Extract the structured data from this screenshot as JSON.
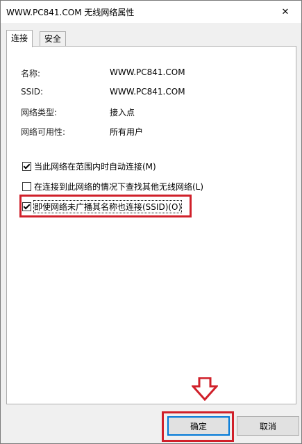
{
  "window": {
    "title": "WWW.PC841.COM 无线网络属性",
    "close_glyph": "✕"
  },
  "tabs": [
    {
      "label": "连接",
      "active": true
    },
    {
      "label": "安全",
      "active": false
    }
  ],
  "properties": [
    {
      "label": "名称:",
      "value": "WWW.PC841.COM"
    },
    {
      "label": "SSID:",
      "value": "WWW.PC841.COM"
    },
    {
      "label": "网络类型:",
      "value": "接入点"
    },
    {
      "label": "网络可用性:",
      "value": "所有用户"
    }
  ],
  "options": [
    {
      "label": "当此网络在范围内时自动连接(M)",
      "checked": true
    },
    {
      "label": "在连接到此网络的情况下查找其他无线网络(L)",
      "checked": false
    },
    {
      "label": "即使网络未广播其名称也连接(SSID)(O)",
      "checked": true
    }
  ],
  "buttons": {
    "ok": "确定",
    "cancel": "取消"
  },
  "colors": {
    "highlight": "#d0202a",
    "accent": "#0078d7"
  }
}
